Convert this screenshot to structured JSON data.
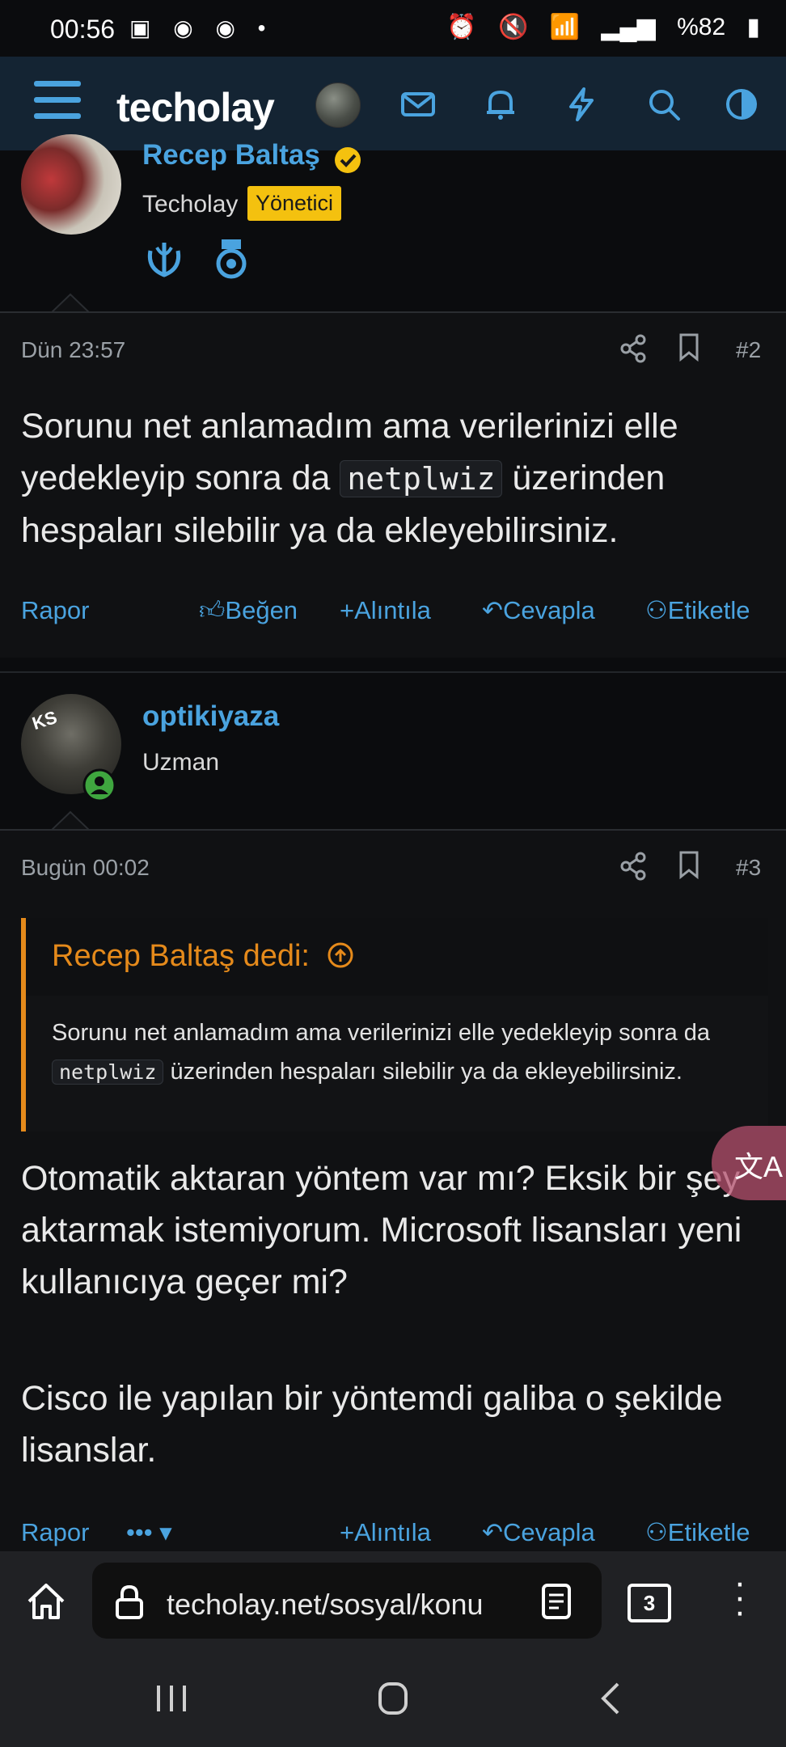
{
  "status_bar": {
    "time": "00:56",
    "battery": "%82"
  },
  "top_nav": {
    "logo": "techolay"
  },
  "posts": [
    {
      "username": "Recep Baltaş",
      "subtitle": "Techolay",
      "badge": "Yönetici",
      "date": "Dün 23:57",
      "number": "#2",
      "body_before": "Sorunu net anlamadım ama verilerinizi elle yedekleyip sonra da ",
      "code": "netplwiz",
      "body_after": " üzerinden hespaları silebilir ya da ekleyebilirsiniz.",
      "actions": {
        "report": "Rapor",
        "like": "Beğen",
        "quote": "Alıntıla",
        "reply": "Cevapla",
        "tag": "Etiketle"
      }
    },
    {
      "username": "optikiyaza",
      "subtitle": "Uzman",
      "avatar_initials": "KS",
      "date": "Bugün 00:02",
      "number": "#3",
      "quote": {
        "header": "Recep Baltaş dedi:",
        "text_before": "Sorunu net anlamadım ama verilerinizi elle yedekleyip sonra da ",
        "code": "netplwiz",
        "text_after": " üzerinden hespaları silebilir ya da ekleyebilirsiniz."
      },
      "paragraph1": "Otomatik aktaran yöntem var mı? Eksik bir şey aktarmak istemiyorum. Microsoft lisansları yeni kullanıcıya geçer mi?",
      "paragraph2": "Cisco ile yapılan bir yöntemdi galiba o şekilde lisanslar.",
      "actions": {
        "report": "Rapor",
        "more": "•••",
        "quote": "Alıntıla",
        "reply": "Cevapla",
        "tag": "Etiketle"
      }
    }
  ],
  "browser": {
    "url": "techolay.net/sosyal/konu",
    "tab_count": "3"
  }
}
